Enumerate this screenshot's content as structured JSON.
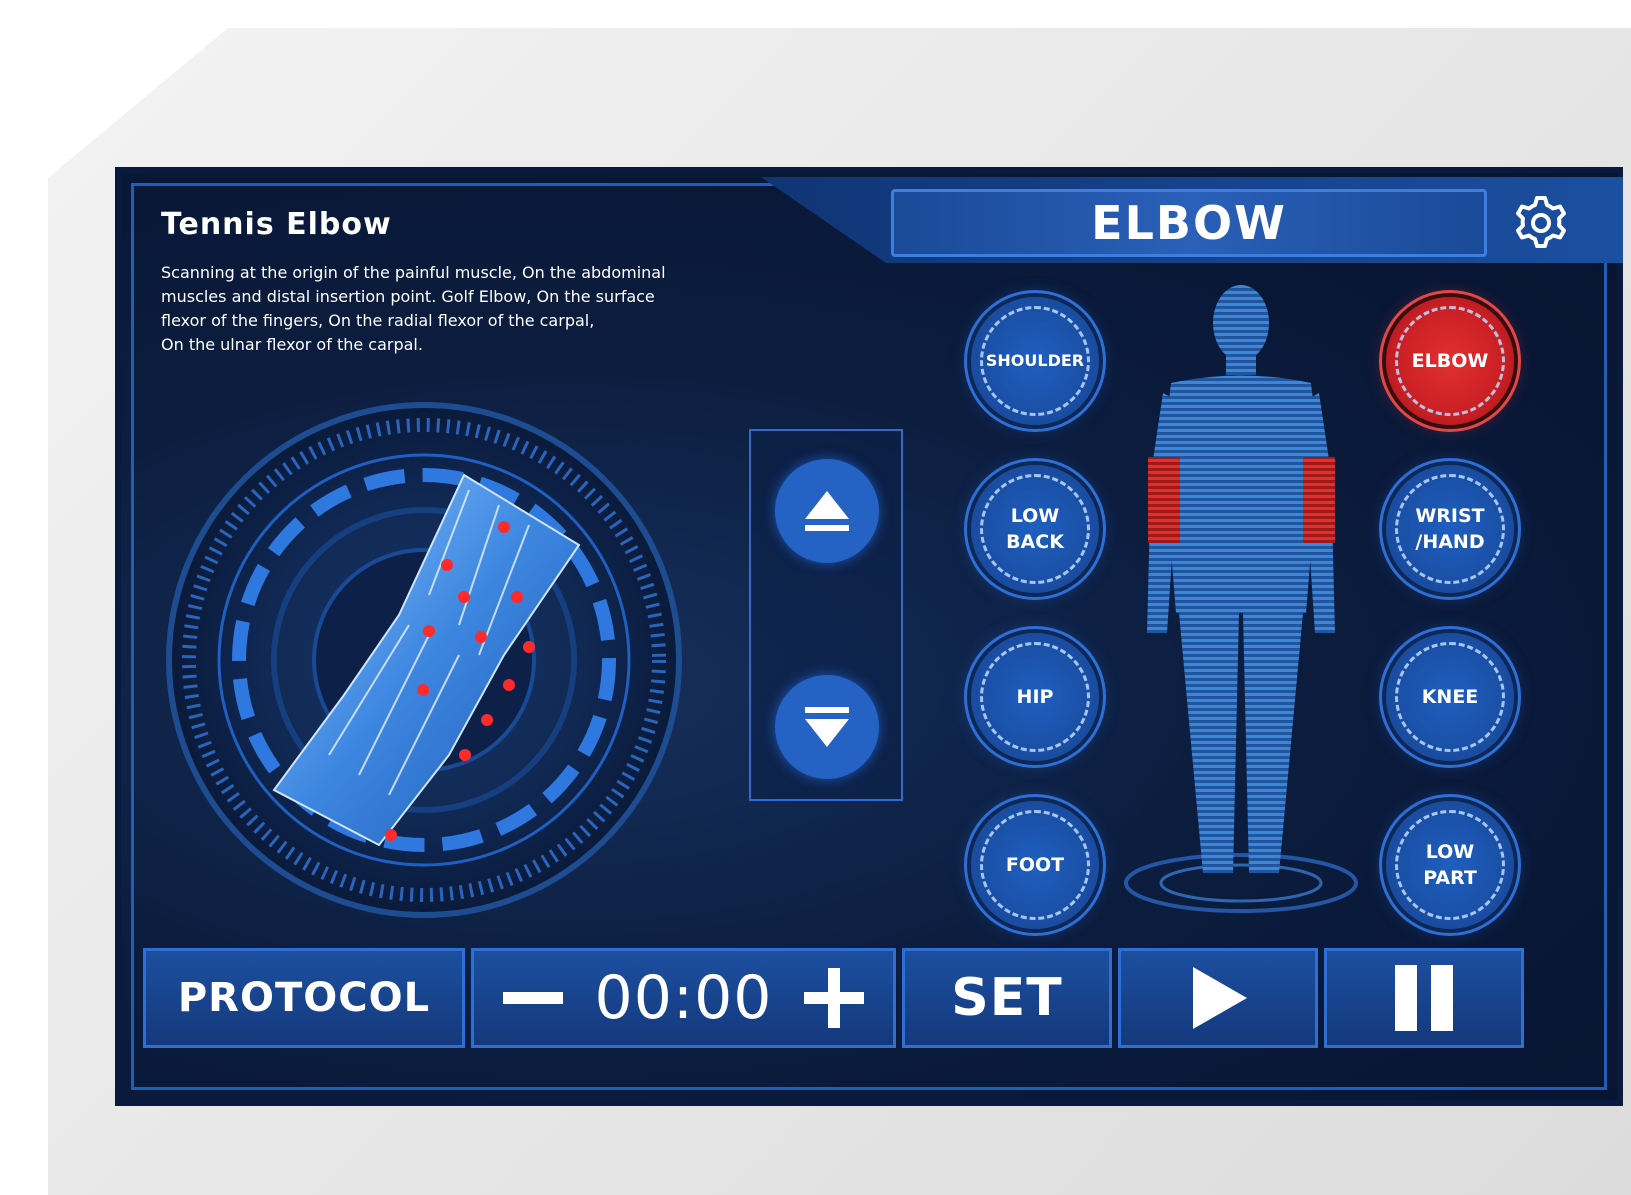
{
  "header": {
    "title": "ELBOW",
    "settings_icon": "gear-icon"
  },
  "topic": {
    "title": "Tennis Elbow",
    "description": "Scanning at the origin of the painful muscle, On the abdominal\nmuscles and distal insertion point. Golf Elbow, On the surface\nflexor of the fingers, On the radial flexor of the carpal,\nOn the ulnar flexor of the carpal."
  },
  "navigation": {
    "up_icon": "eject-up-icon",
    "down_icon": "eject-down-icon"
  },
  "body_parts": {
    "left": [
      {
        "label": "SHOULDER",
        "active": false
      },
      {
        "label": "LOW\nBACK",
        "active": false
      },
      {
        "label": "HIP",
        "active": false
      },
      {
        "label": "FOOT",
        "active": false
      }
    ],
    "right": [
      {
        "label": "ELBOW",
        "active": true
      },
      {
        "label": "WRIST\n/HAND",
        "active": false
      },
      {
        "label": "KNEE",
        "active": false
      },
      {
        "label": "LOW\nPART",
        "active": false
      }
    ]
  },
  "bottom_bar": {
    "protocol_label": "PROTOCOL",
    "timer": "00:00",
    "minus_icon": "minus-icon",
    "plus_icon": "plus-icon",
    "set_label": "SET",
    "play_icon": "play-icon",
    "pause_icon": "pause-icon"
  },
  "colors": {
    "background": "#0c1d3f",
    "accent_blue": "#2463c4",
    "highlight_red": "#d62828"
  }
}
